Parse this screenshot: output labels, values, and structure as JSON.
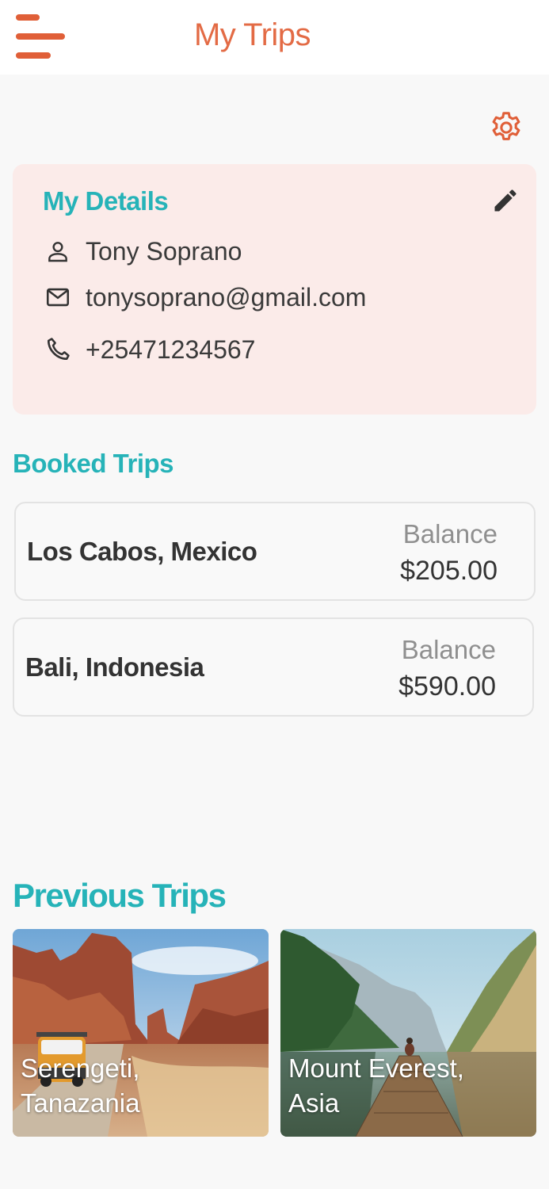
{
  "header": {
    "title": "My Trips",
    "accent_color": "#e05f38",
    "menu_icon": "hamburger-menu-icon"
  },
  "settings": {
    "icon": "gear-icon"
  },
  "details": {
    "title": "My Details",
    "edit_icon": "pencil-icon",
    "name": "Tony Soprano",
    "email": "tonysoprano@gmail.com",
    "phone": "+25471234567",
    "title_color": "#26b3b8",
    "card_color": "#fbebe9"
  },
  "booked": {
    "title": "Booked Trips",
    "trips": [
      {
        "destination": "Los Cabos, Mexico",
        "balance_label": "Balance",
        "balance": "$205.00"
      },
      {
        "destination": "Bali, Indonesia",
        "balance_label": "Balance",
        "balance": "$590.00"
      }
    ]
  },
  "previous": {
    "title": "Previous Trips",
    "trips": [
      {
        "caption": "Serengeti,\nTanazania"
      },
      {
        "caption": "Mount Everest,\nAsia"
      }
    ]
  }
}
